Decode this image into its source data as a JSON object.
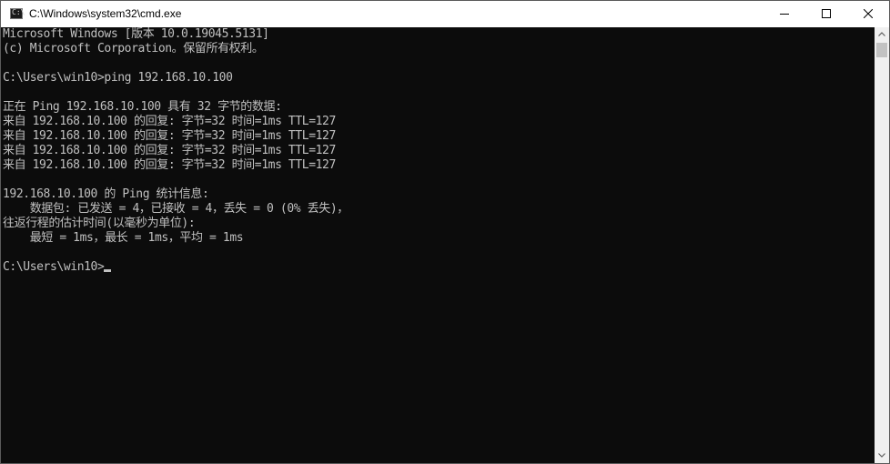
{
  "window": {
    "title": "C:\\Windows\\system32\\cmd.exe",
    "icon": "cmd-icon",
    "icon_glyph": "C:\\",
    "controls": [
      "minimize-icon",
      "maximize-icon",
      "close-icon"
    ]
  },
  "console": {
    "lines": [
      "Microsoft Windows [版本 10.0.19045.5131]",
      "(c) Microsoft Corporation。保留所有权利。",
      "",
      "C:\\Users\\win10>ping 192.168.10.100",
      "",
      "正在 Ping 192.168.10.100 具有 32 字节的数据:",
      "来自 192.168.10.100 的回复: 字节=32 时间=1ms TTL=127",
      "来自 192.168.10.100 的回复: 字节=32 时间=1ms TTL=127",
      "来自 192.168.10.100 的回复: 字节=32 时间=1ms TTL=127",
      "来自 192.168.10.100 的回复: 字节=32 时间=1ms TTL=127",
      "",
      "192.168.10.100 的 Ping 统计信息:",
      "    数据包: 已发送 = 4，已接收 = 4，丢失 = 0 (0% 丢失)，",
      "往返行程的估计时间(以毫秒为单位):",
      "    最短 = 1ms，最长 = 1ms，平均 = 1ms",
      "",
      "C:\\Users\\win10>"
    ]
  },
  "colors": {
    "console_bg": "#0c0c0c",
    "console_fg": "#c0c0c0"
  }
}
